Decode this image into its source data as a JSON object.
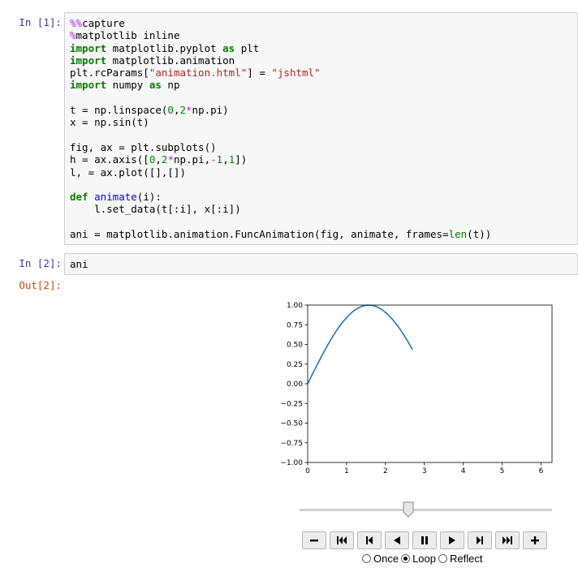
{
  "cells": [
    {
      "prompt": "In [1]:",
      "lines": [
        [
          [
            "m",
            "%%"
          ],
          [
            "",
            "capture"
          ]
        ],
        [
          [
            "m",
            "%"
          ],
          [
            "",
            "matplotlib inline"
          ]
        ],
        [
          [
            "k",
            "import"
          ],
          [
            "",
            " matplotlib.pyplot "
          ],
          [
            "k",
            "as"
          ],
          [
            "",
            " plt"
          ]
        ],
        [
          [
            "k",
            "import"
          ],
          [
            "",
            " matplotlib.animation"
          ]
        ],
        [
          [
            "",
            "plt.rcParams["
          ],
          [
            "s",
            "\"animation.html\""
          ],
          [
            "",
            "] = "
          ],
          [
            "s",
            "\"jshtml\""
          ]
        ],
        [
          [
            "k",
            "import"
          ],
          [
            "",
            " numpy "
          ],
          [
            "k",
            "as"
          ],
          [
            "",
            " np"
          ]
        ],
        [
          [
            "",
            ""
          ]
        ],
        [
          [
            "",
            "t = np.linspace("
          ],
          [
            "n",
            "0"
          ],
          [
            "",
            ","
          ],
          [
            "n",
            "2"
          ],
          [
            "m",
            "*"
          ],
          [
            "",
            "np.pi)"
          ]
        ],
        [
          [
            "",
            "x = np.sin(t)"
          ]
        ],
        [
          [
            "",
            ""
          ]
        ],
        [
          [
            "",
            "fig, ax = plt.subplots()"
          ]
        ],
        [
          [
            "",
            "h = ax.axis(["
          ],
          [
            "n",
            "0"
          ],
          [
            "",
            ","
          ],
          [
            "n",
            "2"
          ],
          [
            "m",
            "*"
          ],
          [
            "",
            "np.pi,"
          ],
          [
            "m",
            "-"
          ],
          [
            "n",
            "1"
          ],
          [
            "",
            ","
          ],
          [
            "n",
            "1"
          ],
          [
            "",
            "])"
          ]
        ],
        [
          [
            "",
            "l, = ax.plot([],[])"
          ]
        ],
        [
          [
            "",
            ""
          ]
        ],
        [
          [
            "k",
            "def"
          ],
          [
            "",
            "",
            " "
          ],
          [
            "fn",
            "animate"
          ],
          [
            "",
            "(i):"
          ]
        ],
        [
          [
            "",
            "    l.set_data(t[:i], x[:i])"
          ]
        ],
        [
          [
            "",
            ""
          ]
        ],
        [
          [
            "",
            "ani = matplotlib.animation.FuncAnimation(fig, animate, frames="
          ],
          [
            "bi",
            "len"
          ],
          [
            "",
            "(t))"
          ]
        ]
      ]
    },
    {
      "prompt": "In [2]:",
      "lines": [
        [
          [
            "",
            "ani"
          ]
        ]
      ]
    }
  ],
  "output_prompt": "Out[2]:",
  "chart_data": {
    "type": "line",
    "title": "",
    "xlabel": "",
    "ylabel": "",
    "xlim": [
      0,
      6.283
    ],
    "ylim": [
      -1.0,
      1.0
    ],
    "xticks": [
      "0",
      "1",
      "2",
      "3",
      "4",
      "5",
      "6"
    ],
    "yticks": [
      "−1.00",
      "−0.75",
      "−0.50",
      "−0.25",
      "0.00",
      "0.25",
      "0.50",
      "0.75",
      "1.00"
    ],
    "series": [
      {
        "color": "#1f77b4",
        "x": [
          0,
          0.128,
          0.256,
          0.385,
          0.513,
          0.641,
          0.769,
          0.898,
          1.026,
          1.154,
          1.282,
          1.411,
          1.539,
          1.667,
          1.795,
          1.923,
          2.052,
          2.18,
          2.308,
          2.436,
          2.565,
          2.693
        ],
        "y": [
          0,
          0.128,
          0.254,
          0.375,
          0.491,
          0.598,
          0.696,
          0.782,
          0.855,
          0.915,
          0.959,
          0.987,
          1.0,
          0.995,
          0.975,
          0.938,
          0.886,
          0.819,
          0.74,
          0.648,
          0.546,
          0.434
        ]
      }
    ],
    "grid": false
  },
  "player": {
    "slider_fraction": 0.43,
    "buttons": [
      {
        "name": "decrease-speed-button",
        "icon": "minus-icon"
      },
      {
        "name": "first-frame-button",
        "icon": "skip-first-icon"
      },
      {
        "name": "previous-frame-button",
        "icon": "step-back-icon"
      },
      {
        "name": "play-reverse-button",
        "icon": "play-reverse-icon"
      },
      {
        "name": "pause-button",
        "icon": "pause-icon"
      },
      {
        "name": "play-button",
        "icon": "play-icon"
      },
      {
        "name": "next-frame-button",
        "icon": "step-forward-icon"
      },
      {
        "name": "last-frame-button",
        "icon": "skip-last-icon"
      },
      {
        "name": "increase-speed-button",
        "icon": "plus-icon"
      }
    ],
    "modes": [
      {
        "label": "Once",
        "selected": false
      },
      {
        "label": "Loop",
        "selected": true
      },
      {
        "label": "Reflect",
        "selected": false
      }
    ]
  }
}
